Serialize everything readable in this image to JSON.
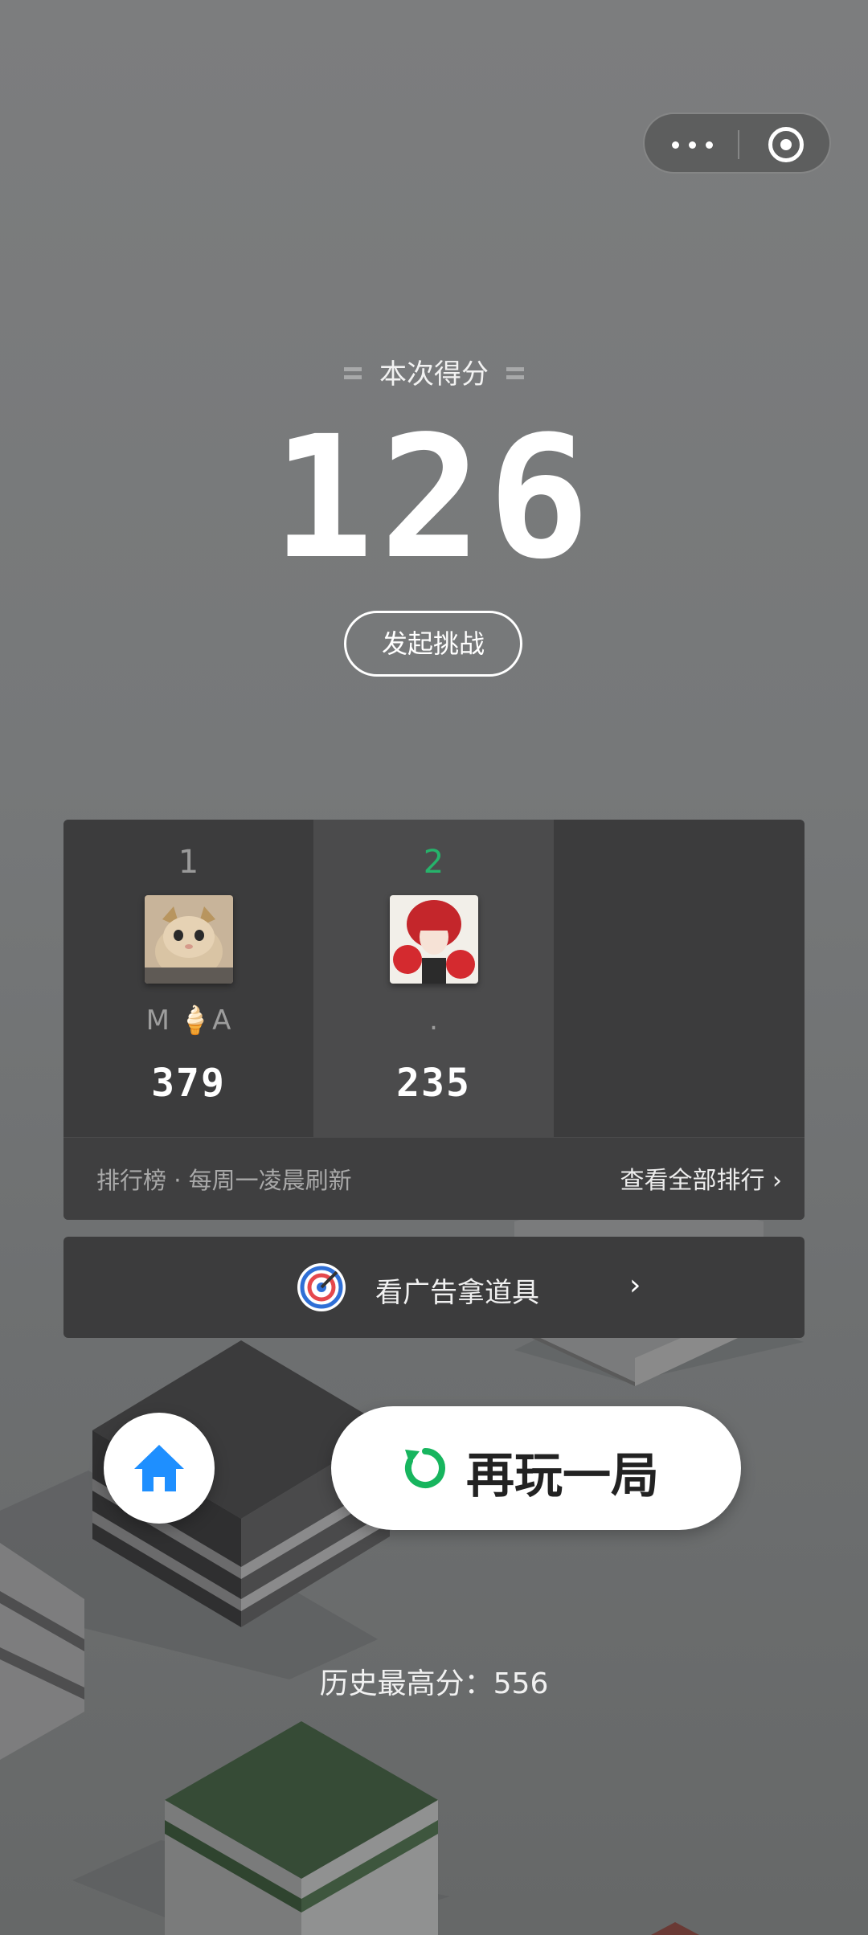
{
  "capsule": {
    "more_icon": "more-dots-icon",
    "close_icon": "target-circle-icon"
  },
  "score": {
    "label": "本次得分",
    "value": "126",
    "challenge_label": "发起挑战"
  },
  "leaderboard": {
    "entries": [
      {
        "rank": "1",
        "name": "M 🍦A",
        "score": "379"
      },
      {
        "rank": "2",
        "name": ".",
        "score": "235"
      }
    ],
    "note": "排行榜 · 每周一凌晨刷新",
    "view_all": "查看全部排行 ›"
  },
  "ad": {
    "label": "看广告拿道具",
    "arrow": "›"
  },
  "actions": {
    "replay_label": "再玩一局"
  },
  "best": {
    "text": "历史最高分：556"
  },
  "colors": {
    "accent_green": "#26b36b",
    "home_blue": "#1e8fff"
  }
}
